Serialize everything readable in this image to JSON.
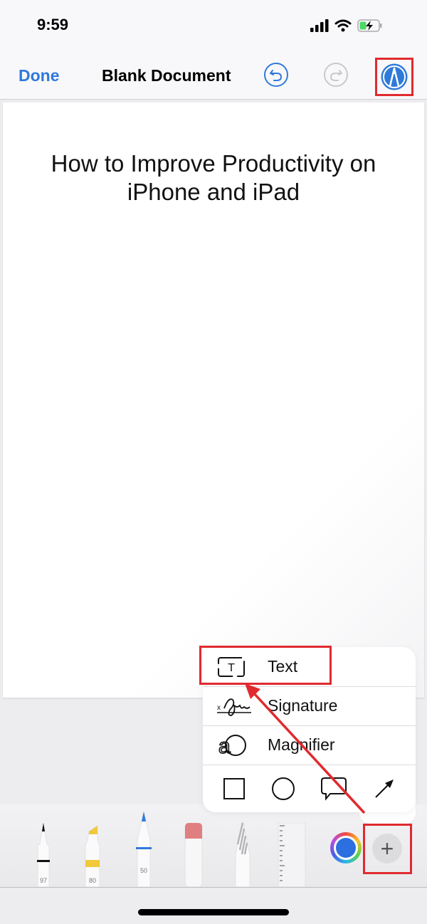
{
  "status_bar": {
    "time": "9:59",
    "icons": [
      "signal-icon",
      "wifi-icon",
      "battery-charging-icon"
    ]
  },
  "nav": {
    "done_label": "Done",
    "title": "Blank Document",
    "undo_icon": "undo-icon",
    "redo_icon": "redo-icon",
    "markup_icon": "markup-pen-icon"
  },
  "document": {
    "heading_line1": "How to Improve Productivity on",
    "heading_line2": "iPhone and iPad"
  },
  "popup_menu": {
    "items": [
      {
        "label": "Text",
        "icon": "text-box-icon"
      },
      {
        "label": "Signature",
        "icon": "signature-icon"
      },
      {
        "label": "Magnifier",
        "icon": "magnifier-icon"
      }
    ],
    "shapes": [
      "square-shape-icon",
      "circle-shape-icon",
      "speech-bubble-shape-icon",
      "arrow-shape-icon"
    ]
  },
  "toolbar": {
    "tools": [
      {
        "name": "pen",
        "value": "97",
        "color": "#111111"
      },
      {
        "name": "highlighter",
        "value": "80",
        "color": "#f1c93b"
      },
      {
        "name": "pencil",
        "value": "50",
        "color": "#2f7ad9"
      },
      {
        "name": "eraser",
        "value": "",
        "color": "#e07f7f"
      },
      {
        "name": "lasso",
        "value": "",
        "color": "#bbbbbb"
      },
      {
        "name": "ruler",
        "value": "",
        "color": "#cccccc"
      }
    ],
    "selected_color": "#2b6fe0",
    "add_label": "+"
  },
  "colors": {
    "accent": "#2f7ad9",
    "annotation_red": "#e02a2f"
  }
}
